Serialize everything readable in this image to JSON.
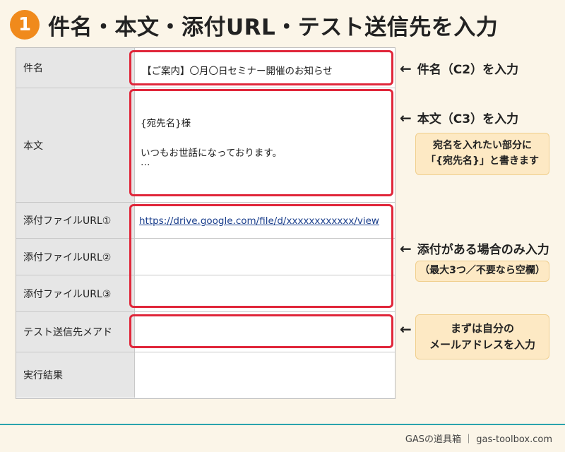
{
  "header": {
    "step_number": "1",
    "title": "件名・本文・添付URL・テスト送信先を入力"
  },
  "sheet": {
    "rows": [
      {
        "label": "件名",
        "value": "【ご案内】〇月〇日セミナー開催のお知らせ"
      },
      {
        "label": "本文",
        "value_lines": [
          "{宛先名}様",
          "",
          "いつもお世話になっております。",
          "…"
        ]
      },
      {
        "label": "添付ファイルURL①",
        "value": "https://drive.google.com/file/d/xxxxxxxxxxxx/view"
      },
      {
        "label": "添付ファイルURL②",
        "value": ""
      },
      {
        "label": "添付ファイルURL③",
        "value": ""
      },
      {
        "label": "テスト送信先メアド",
        "value": ""
      },
      {
        "label": "実行結果",
        "value": ""
      }
    ]
  },
  "annotations": {
    "arrow_glyph": "←",
    "subject": "件名（C2）を入力",
    "body": "本文（C3）を入力",
    "body_note_lines": [
      "宛名を入れたい部分に",
      "「{宛先名}」と書きます"
    ],
    "attach": "添付がある場合のみ入力",
    "attach_note": "（最大3つ／不要なら空欄）",
    "test_lines": [
      "まずは自分の",
      "メールアドレスを入力"
    ]
  },
  "footer": {
    "text": "GASの道具箱 ｜ gas-toolbox.com"
  },
  "colors": {
    "accent": "#f08a1c",
    "highlight": "#e0263a",
    "note_bg": "#fde9c4",
    "footer_line": "#2aa3ad",
    "link": "#1a3e8c"
  }
}
